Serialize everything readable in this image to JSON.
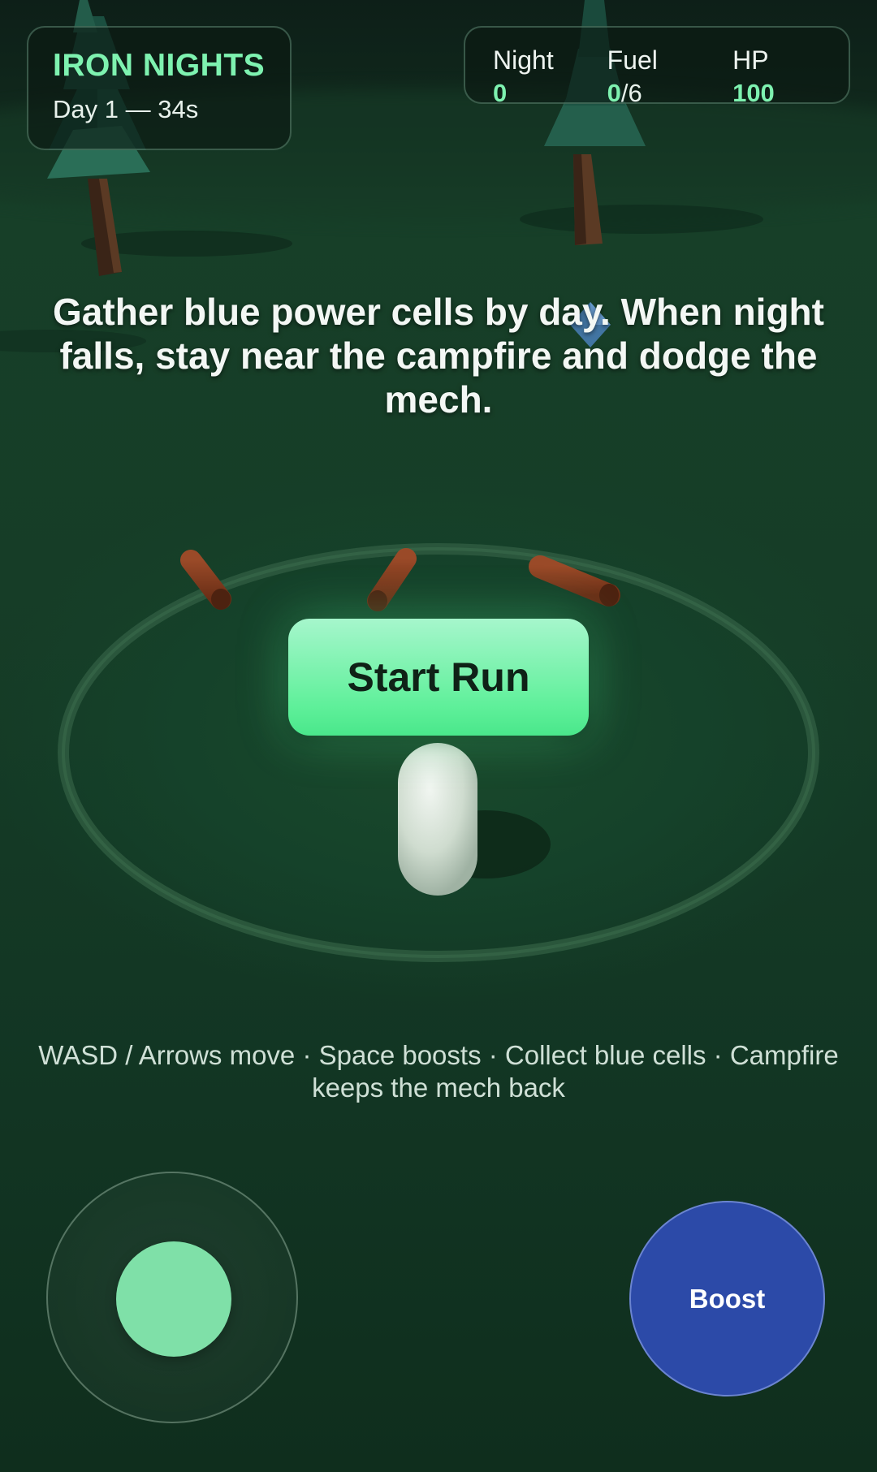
{
  "hud": {
    "title": "IRON NIGHTS",
    "day_status": "Day 1 — 34s",
    "stats": {
      "night_label": "Night",
      "night_value": "0",
      "fuel_label": "Fuel",
      "fuel_collected": "0",
      "fuel_total": "/6",
      "hp_label": "HP",
      "hp_value": "100"
    }
  },
  "instructions": "Gather blue power cells by day. When night falls, stay near the campfire and dodge the mech.",
  "start_button_label": "Start Run",
  "controls_hint": "WASD / Arrows move · Space boosts · Collect blue cells · Campfire keeps the mech back",
  "boost_button_label": "Boost",
  "colors": {
    "accent_green": "#7ef2b0",
    "start_button": "#5ff09a",
    "boost_button": "#2c4aa8",
    "ground": "#163d27"
  },
  "scene": {
    "objects": [
      "pine-tree",
      "pine-tree",
      "log",
      "log",
      "log",
      "power-cell",
      "player-capsule",
      "campfire-ring"
    ]
  }
}
